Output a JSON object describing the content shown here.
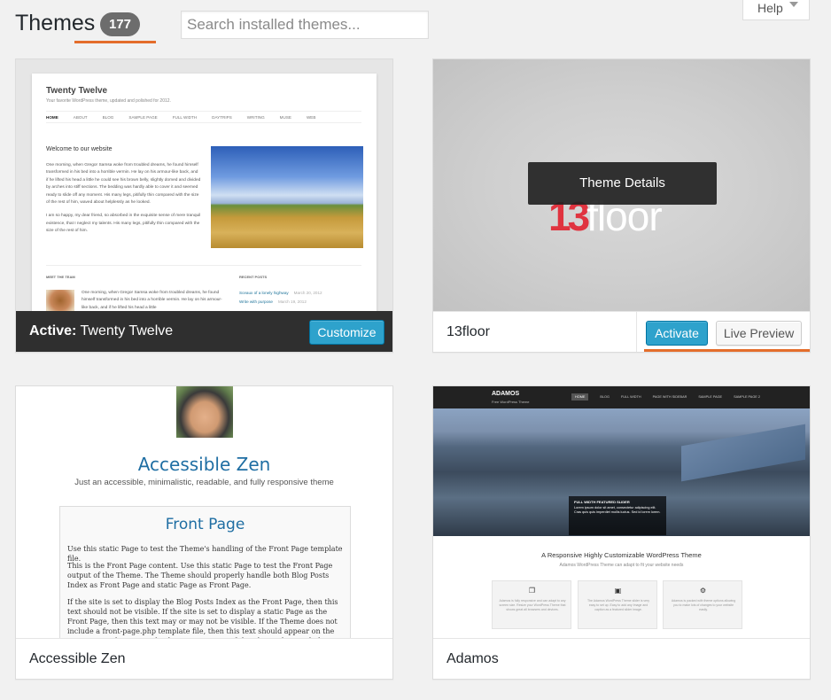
{
  "header": {
    "title": "Themes",
    "count": "177",
    "search_placeholder": "Search installed themes...",
    "help_label": "Help"
  },
  "themes": [
    {
      "name": "Twenty Twelve",
      "active_prefix": "Active:",
      "button": "Customize",
      "preview": {
        "site_title": "Twenty Twelve",
        "tagline": "Your favorite WordPress theme, updated and polished for 2012.",
        "nav": [
          "HOME",
          "ABOUT",
          "BLOG",
          "SAMPLE PAGE",
          "FULL WIDTH",
          "DAYTRIPS",
          "WRITING",
          "MUSE",
          "WEB"
        ],
        "heading": "Welcome to our website",
        "body_1": "One morning, when Gregor Samsa woke from troubled dreams, he found himself transformed in his bed into a horrible vermin. He lay on his armour-like back, and if he lifted his head a little he could see his brown belly, slightly domed and divided by arches into stiff sections. The bedding was hardly able to cover it and seemed ready to slide off any moment. His many legs, pitifully thin compared with the size of the rest of him, waved about helplessly as he looked.",
        "body_2": "I am so happy, my dear friend, so absorbed in the exquisite sense of mere tranquil existence, that I neglect my talents. His many legs, pitifully thin compared with the size of the rest of him.",
        "team_heading": "MEET THE TEAM",
        "team_text": "One morning, when Gregor Samsa woke from troubled dreams, he found himself transformed in his bed into a horrible vermin. He lay on his armour-like back, and if he lifted his head a little",
        "recent_heading": "RECENT POSTS",
        "post_1": "Sceaux of a lonely highway",
        "post_1_date": "March 20, 2012",
        "post_2": "Write with purpose",
        "post_2_date": "March 19, 2012"
      }
    },
    {
      "name": "13floor",
      "overlay": "Theme Details",
      "activate": "Activate",
      "live_preview": "Live Preview",
      "logo_num": "13",
      "logo_text": "floor"
    },
    {
      "name": "Accessible Zen",
      "preview": {
        "title": "Accessible Zen",
        "subtitle": "Just an accessible, minimalistic, readable, and fully responsive theme",
        "box_title": "Front Page",
        "p1": "Use this static Page to test the Theme's handling of the Front Page template file.",
        "p2": "This is the Front Page content. Use this static Page to test the Front Page output of the Theme. The Theme should properly handle both Blog Posts Index as Front Page and static Page as Front Page.",
        "p3": "If the site is set to display the Blog Posts Index as the Front Page, then this text should not be visible. If the site is set to display a static Page as the Front Page, then this text may or may not be visible. If the Theme does not include a front-page.php template file, then this text should appear on the Front Page when set to display a static Page. If the Theme does include a front-page.php template file, then this text may or may not appear."
      }
    },
    {
      "name": "Adamos",
      "preview": {
        "brand": "ADAMOS",
        "brand_sub": "Free WordPress Theme",
        "nav": [
          "HOME",
          "BLOG",
          "FULL WIDTH",
          "PAGE WITH SIDEBAR",
          "SAMPLE PAGE",
          "SAMPLE PAGE 2"
        ],
        "slider_title": "FULL WIDTH FEATURED SLIDER",
        "slider_text": "Lorem ipsum dolor sit amet, consectetur adipiscing elit. Cras quis quis imperdiet mollis luctus. Sed id lorem lorem.",
        "heading": "A Responsive Highly Customizable WordPress Theme",
        "subheading": "Adamos WordPress Theme can adapt to fit your website needs",
        "box_1": "Adamos is fully responsive and can adapt to any screen size. Resize your WordPress Theme that shows great all browsers and devices.",
        "box_2": "The Adamos WordPress Theme slider is very easy to set up. Easy to add any Image and caption as a featured slider image.",
        "box_3": "Adamos is packed with theme options allowing you to make lots of changes to your website easily."
      }
    }
  ]
}
